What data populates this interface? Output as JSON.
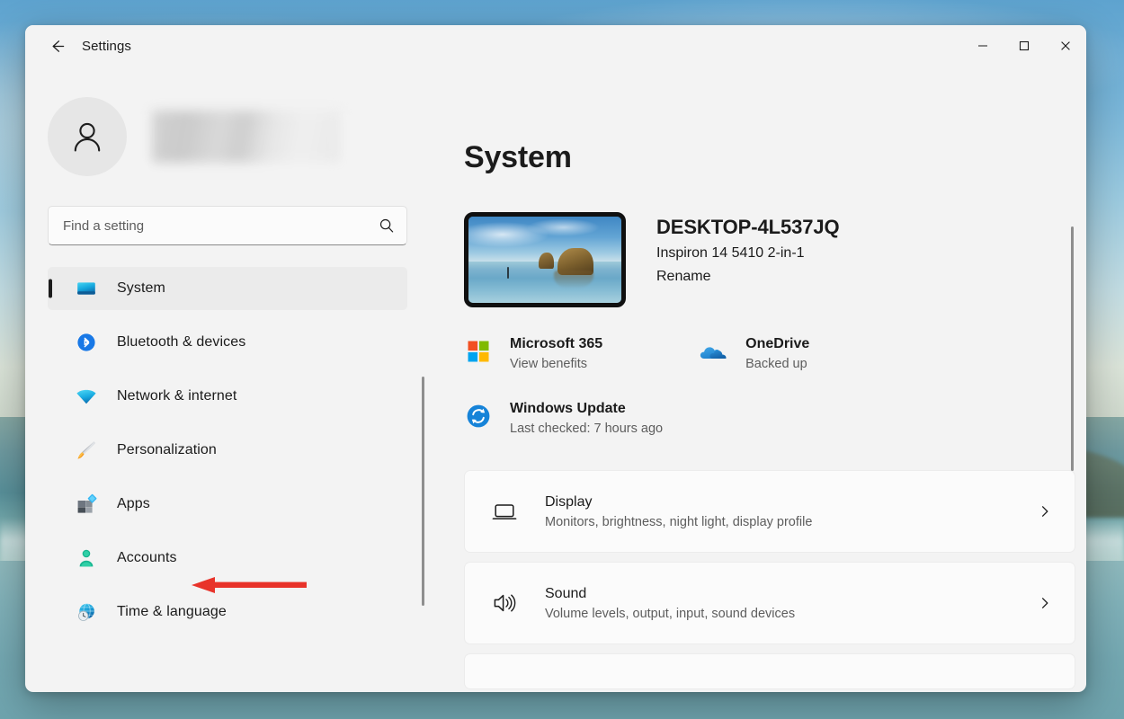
{
  "window": {
    "title": "Settings",
    "back_icon": "back-arrow-icon",
    "controls": {
      "minimize": "minimize-icon",
      "maximize": "maximize-icon",
      "close": "close-icon"
    }
  },
  "sidebar": {
    "account": {
      "avatar_icon": "person-avatar-icon",
      "name_redacted": ""
    },
    "search": {
      "placeholder": "Find a setting",
      "value": "",
      "icon": "search-icon"
    },
    "items": [
      {
        "label": "System",
        "icon": "system-monitor-icon",
        "selected": true
      },
      {
        "label": "Bluetooth & devices",
        "icon": "bluetooth-icon",
        "selected": false
      },
      {
        "label": "Network & internet",
        "icon": "wifi-icon",
        "selected": false
      },
      {
        "label": "Personalization",
        "icon": "paintbrush-icon",
        "selected": false
      },
      {
        "label": "Apps",
        "icon": "apps-grid-icon",
        "selected": false
      },
      {
        "label": "Accounts",
        "icon": "person-accounts-icon",
        "selected": false
      },
      {
        "label": "Time & language",
        "icon": "globe-clock-icon",
        "selected": false
      }
    ]
  },
  "content": {
    "page_title": "System",
    "device": {
      "thumbnail_icon": "device-wallpaper-thumbnail",
      "name": "DESKTOP-4L537JQ",
      "model": "Inspiron 14 5410 2-in-1",
      "rename_label": "Rename"
    },
    "quick_links": [
      {
        "title": "Microsoft 365",
        "subtitle": "View benefits",
        "icon": "microsoft-logo-icon"
      },
      {
        "title": "OneDrive",
        "subtitle": "Backed up",
        "icon": "onedrive-cloud-icon"
      },
      {
        "title": "Windows Update",
        "subtitle": "Last checked: 7 hours ago",
        "icon": "windows-update-icon"
      }
    ],
    "cards": [
      {
        "title": "Display",
        "subtitle": "Monitors, brightness, night light, display profile",
        "icon": "display-monitor-icon",
        "chevron": "chevron-right-icon"
      },
      {
        "title": "Sound",
        "subtitle": "Volume levels, output, input, sound devices",
        "icon": "speaker-icon",
        "chevron": "chevron-right-icon"
      }
    ]
  },
  "annotation": {
    "arrow_icon": "red-arrow-pointing-left",
    "color": "#e8332a",
    "points_at": "Accounts"
  },
  "colors": {
    "window_background": "#f3f3f3",
    "card_background": "#fbfbfb",
    "selected_nav_background": "#ebebeb",
    "accent_pill": "#1c1c1c",
    "text_primary": "#1b1b1b",
    "text_secondary": "#5d5d5d",
    "annotation_red": "#e8332a"
  }
}
